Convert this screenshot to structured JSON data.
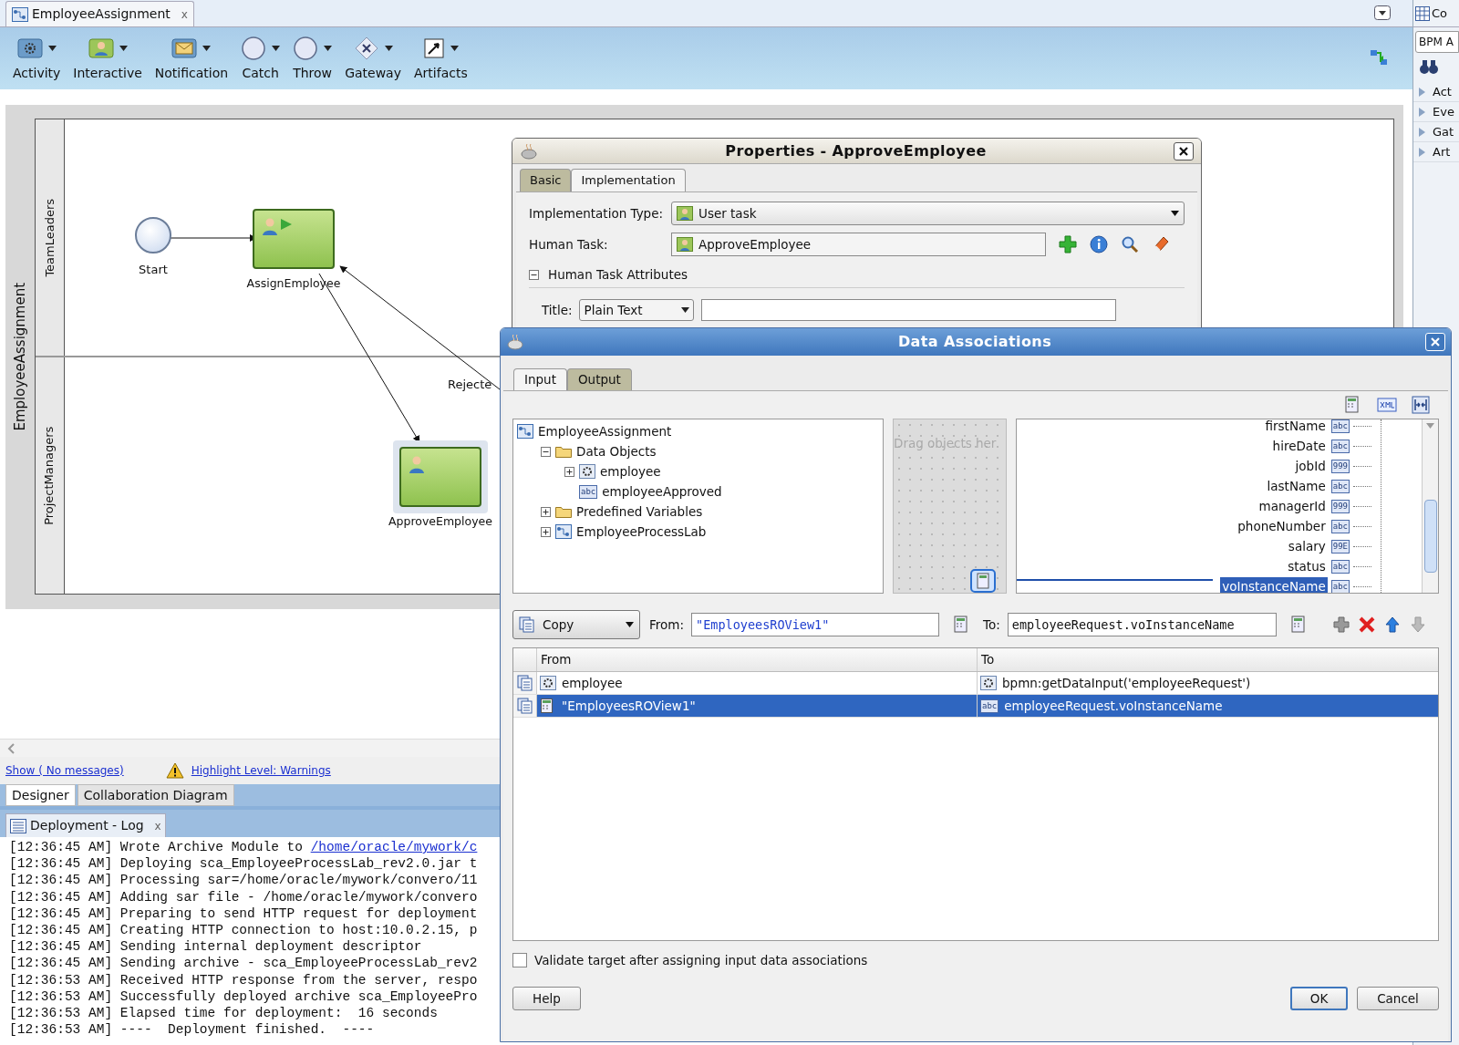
{
  "editor_tab": {
    "title": "EmployeeAssignment",
    "close": "x"
  },
  "toolbar": [
    {
      "label": "Activity",
      "kind": "activity"
    },
    {
      "label": "Interactive",
      "kind": "interactive"
    },
    {
      "label": "Notification",
      "kind": "notification"
    },
    {
      "label": "Catch",
      "kind": "event"
    },
    {
      "label": "Throw",
      "kind": "event"
    },
    {
      "label": "Gateway",
      "kind": "gateway"
    },
    {
      "label": "Artifacts",
      "kind": "artifact"
    }
  ],
  "diagram": {
    "pool": "EmployeeAssignment",
    "lanes": [
      {
        "name": "TeamLeaders"
      },
      {
        "name": "ProjectManagers"
      }
    ],
    "nodes": [
      {
        "kind": "start",
        "label": "Start",
        "selected": false
      },
      {
        "kind": "task",
        "label": "AssignEmployee",
        "selected": false
      },
      {
        "kind": "task",
        "label": "ApproveEmployee",
        "selected": true
      }
    ],
    "edge_label": "Rejecte"
  },
  "messages": {
    "show": "Show ( No messages)",
    "highlight": "Highlight Level: Warnings"
  },
  "view_tabs": [
    {
      "label": "Designer",
      "selected": true
    },
    {
      "label": "Collaboration Diagram",
      "selected": false
    }
  ],
  "log": {
    "title": "Deployment - Log",
    "close": "x",
    "lines": [
      {
        "text": "[12:36:45 AM] Wrote Archive Module to ",
        "link": "/home/oracle/mywork/c"
      },
      {
        "text": "[12:36:45 AM] Deploying sca_EmployeeProcessLab_rev2.0.jar t"
      },
      {
        "text": "[12:36:45 AM] Processing sar=/home/oracle/mywork/convero/11"
      },
      {
        "text": "[12:36:45 AM] Adding sar file - /home/oracle/mywork/convero"
      },
      {
        "text": "[12:36:45 AM] Preparing to send HTTP request for deployment"
      },
      {
        "text": "[12:36:45 AM] Creating HTTP connection to host:10.0.2.15, p"
      },
      {
        "text": "[12:36:45 AM] Sending internal deployment descriptor"
      },
      {
        "text": "[12:36:45 AM] Sending archive - sca_EmployeeProcessLab_rev2"
      },
      {
        "text": "[12:36:53 AM] Received HTTP response from the server, respo"
      },
      {
        "text": "[12:36:53 AM] Successfully deployed archive sca_EmployeePro"
      },
      {
        "text": "[12:36:53 AM] Elapsed time for deployment:  16 seconds"
      },
      {
        "text": "[12:36:53 AM] ----  Deployment finished.  ----"
      }
    ]
  },
  "palette": {
    "title": "Co",
    "search": "BPM A",
    "sections": [
      "Act",
      "Eve",
      "Gat",
      "Art"
    ]
  },
  "properties_dialog": {
    "title": "Properties - ApproveEmployee",
    "tabs": [
      {
        "label": "Basic",
        "selected": false
      },
      {
        "label": "Implementation",
        "selected": true
      }
    ],
    "implementation_type": {
      "label": "Implementation Type:",
      "value": "User task"
    },
    "human_task": {
      "label": "Human Task:",
      "value": "ApproveEmployee"
    },
    "section": {
      "label": "Human Task Attributes",
      "expanded": true
    },
    "title_row": {
      "label": "Title:",
      "value": "Plain Text"
    }
  },
  "data_associations": {
    "title": "Data Associations",
    "tabs": [
      {
        "label": "Input",
        "selected": true
      },
      {
        "label": "Output",
        "selected": false
      }
    ],
    "source_tree": [
      {
        "label": "EmployeeAssignment",
        "kind": "process",
        "children": [
          {
            "label": "Data Objects",
            "kind": "folder",
            "expanded": true,
            "children": [
              {
                "label": "employee",
                "kind": "object",
                "expanded": false
              },
              {
                "label": "employeeApproved",
                "type": "abc"
              }
            ]
          },
          {
            "label": "Predefined Variables",
            "kind": "folder",
            "expanded": false
          },
          {
            "label": "EmployeeProcessLab",
            "kind": "process",
            "expanded": false
          }
        ]
      }
    ],
    "drop_hint": "Drag objects her",
    "target_fields": [
      {
        "name": "firstName",
        "type": "abc",
        "selected": false
      },
      {
        "name": "hireDate",
        "type": "abc",
        "selected": false
      },
      {
        "name": "jobId",
        "type": "999",
        "selected": false
      },
      {
        "name": "lastName",
        "type": "abc",
        "selected": false
      },
      {
        "name": "managerId",
        "type": "999",
        "selected": false
      },
      {
        "name": "phoneNumber",
        "type": "abc",
        "selected": false
      },
      {
        "name": "salary",
        "type": "99E",
        "selected": false
      },
      {
        "name": "status",
        "type": "abc",
        "selected": false
      },
      {
        "name": "voInstanceName",
        "type": "abc",
        "selected": true
      }
    ],
    "mapping": {
      "operation": "Copy",
      "from_label": "From:",
      "from": "\"EmployeesROView1\"",
      "to_label": "To:",
      "to": "employeeRequest.voInstanceName"
    },
    "table": {
      "columns": [
        "From",
        "To"
      ],
      "rows": [
        {
          "from": {
            "text": "employee",
            "kind": "object"
          },
          "to": {
            "text": "bpmn:getDataInput('employeeRequest')",
            "kind": "object"
          },
          "selected": false
        },
        {
          "from": {
            "text": "\"EmployeesROView1\"",
            "kind": "expression"
          },
          "to": {
            "text": "employeeRequest.voInstanceName",
            "type": "abc"
          },
          "selected": true
        }
      ]
    },
    "validate": {
      "label": "Validate target after assigning input data associations",
      "checked": false
    },
    "buttons": [
      {
        "label": "Help"
      },
      {
        "label": "OK"
      },
      {
        "label": "Cancel"
      }
    ]
  }
}
